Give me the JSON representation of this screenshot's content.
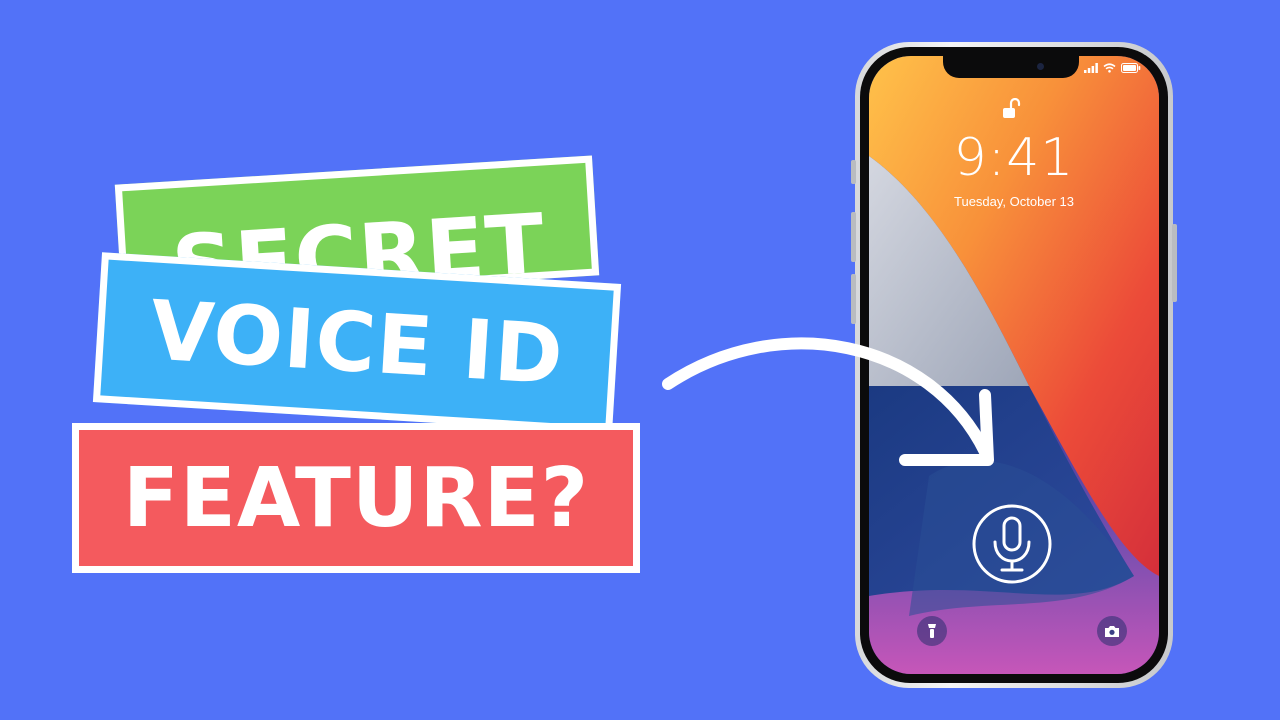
{
  "banners": [
    {
      "text": "SECRET",
      "color": "#7bd358"
    },
    {
      "text": "VOICE ID",
      "color": "#3db1f7"
    },
    {
      "text": "FEATURE?",
      "color": "#f45a5e"
    }
  ],
  "lockscreen": {
    "time": "9:41",
    "date": "Tuesday, October 13"
  },
  "icons": {
    "lock": "unlocked-padlock-icon",
    "mic": "microphone-icon",
    "flashlight": "flashlight-icon",
    "camera": "camera-icon",
    "signal": "cellular-signal-icon",
    "wifi": "wifi-icon",
    "battery": "battery-icon"
  },
  "colors": {
    "background": "#5272f8",
    "banner_border": "#ffffff",
    "arrow": "#ffffff"
  }
}
